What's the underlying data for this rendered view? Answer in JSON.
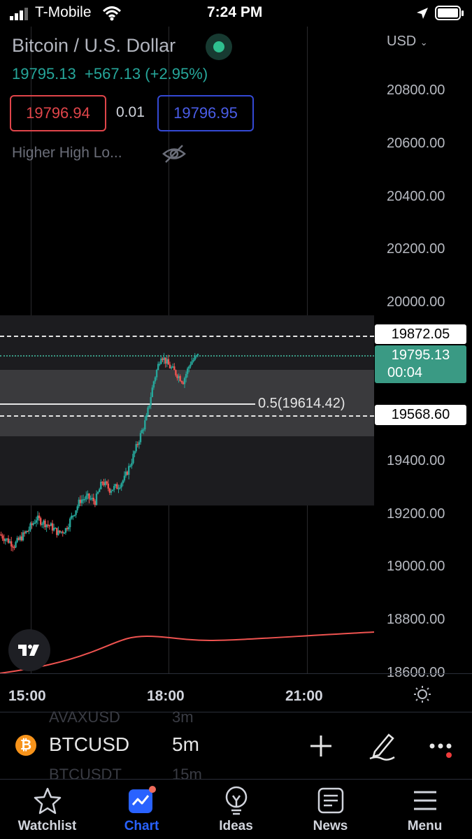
{
  "status_bar": {
    "carrier": "T-Mobile",
    "time": "7:24 PM"
  },
  "header": {
    "title": "Bitcoin / U.S. Dollar",
    "last_price": "19795.13",
    "change": "+567.13",
    "change_pct": "(+2.95%)",
    "bid": "19796.94",
    "spread": "0.01",
    "ask": "19796.95",
    "indicator": "Higher High Lo..."
  },
  "currency": "USD",
  "price_axis": [
    "20800.00",
    "20600.00",
    "20400.00",
    "20200.00",
    "20000.00",
    "19400.00",
    "19200.00",
    "19000.00",
    "18800.00",
    "18600.00"
  ],
  "price_tags": {
    "upper": "19872.05",
    "current_price": "19795.13",
    "countdown": "00:04",
    "lower": "19568.60"
  },
  "fib_label": "0.5(19614.42)",
  "time_axis": [
    "15:00",
    "18:00",
    "21:00"
  ],
  "toolbar": {
    "symbol": "BTCUSD",
    "interval": "5m",
    "ghost_above_symbol": "AVAXUSD",
    "ghost_above_interval": "3m",
    "ghost_below_symbol": "BTCUSDT",
    "ghost_below_interval": "15m"
  },
  "tabs": [
    {
      "label": "Watchlist",
      "icon": "star-icon",
      "active": false
    },
    {
      "label": "Chart",
      "icon": "chart-icon",
      "active": true
    },
    {
      "label": "Ideas",
      "icon": "lightbulb-icon",
      "active": false
    },
    {
      "label": "News",
      "icon": "news-icon",
      "active": false
    },
    {
      "label": "Menu",
      "icon": "menu-icon",
      "active": false
    }
  ],
  "colors": {
    "up": "#26a69a",
    "down": "#ef5350",
    "accent": "#2962ff",
    "bid_border": "#e0454a",
    "ask_border": "#3449d4",
    "current_tag": "#3a9a84"
  },
  "chart_data": {
    "type": "candlestick",
    "interval": "5m",
    "currency": "USD",
    "ylim": [
      18600,
      20800
    ],
    "x_ticks": [
      "15:00",
      "18:00",
      "21:00"
    ],
    "y_ticks": [
      18600,
      18800,
      19000,
      19200,
      19400,
      20000,
      20200,
      20400,
      20600,
      20800
    ],
    "last": 19795.13,
    "levels": {
      "upper": 19872.05,
      "lower": 19568.6,
      "fib_0_5": 19614.42
    },
    "close_path": [
      19120,
      19100,
      19080,
      19110,
      19140,
      19180,
      19165,
      19150,
      19125,
      19140,
      19195,
      19250,
      19260,
      19245,
      19320,
      19290,
      19300,
      19330,
      19400,
      19480,
      19560,
      19700,
      19800,
      19760,
      19730,
      19700,
      19770,
      19795.13
    ]
  }
}
